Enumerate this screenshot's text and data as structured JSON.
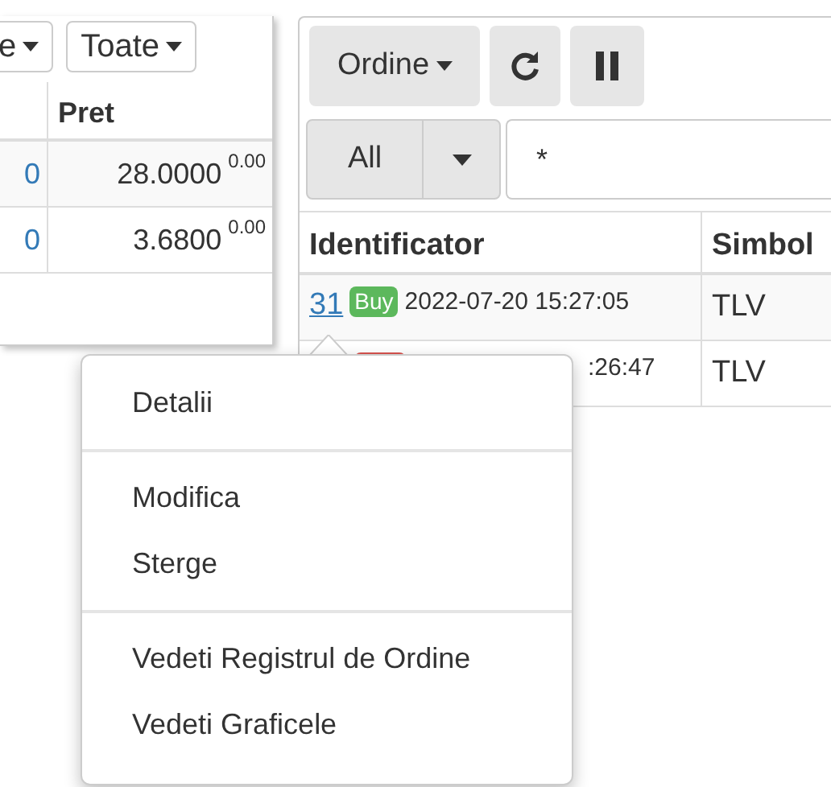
{
  "left_panel": {
    "filters": [
      {
        "label": "e"
      },
      {
        "label": "Toate"
      }
    ],
    "table": {
      "columns": [
        "Pret"
      ],
      "rows": [
        {
          "column_1": "0",
          "pret": "28.0000",
          "change": "0.00"
        },
        {
          "column_1": "0",
          "pret": "3.6800",
          "change": "0.00"
        }
      ]
    }
  },
  "orders_panel": {
    "toolbar": {
      "menu_label": "Ordine"
    },
    "filter": {
      "type_label": "All",
      "value": "*"
    },
    "table": {
      "columns": [
        "Identificator",
        "Simbol"
      ],
      "rows": [
        {
          "id": "31",
          "side": "Buy",
          "kind": "buy",
          "time": "2022-07-20 15:27:05",
          "symbol": "TLV"
        },
        {
          "kind": "sell",
          "time": ":26:47",
          "symbol": "TLV"
        }
      ]
    }
  },
  "context_menu": {
    "groups": [
      [
        "Detalii"
      ],
      [
        "Modifica",
        "Sterge"
      ],
      [
        "Vedeti Registrul de Ordine",
        "Vedeti Graficele"
      ]
    ]
  }
}
